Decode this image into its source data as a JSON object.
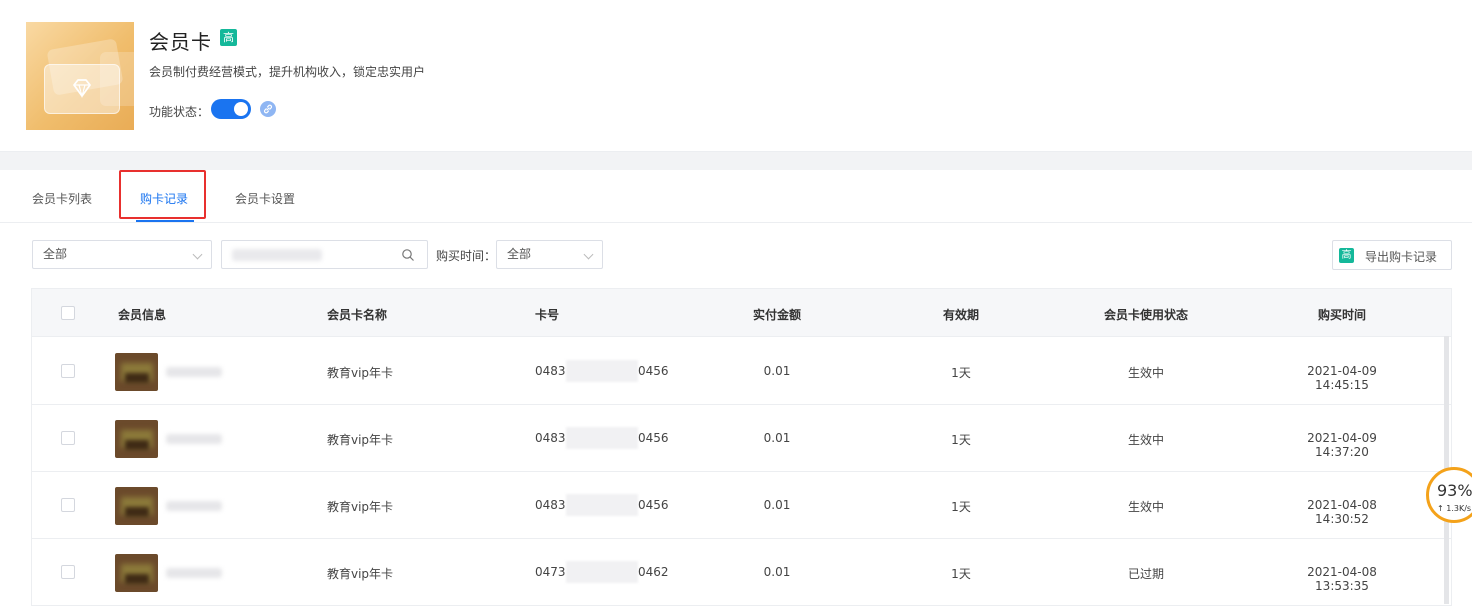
{
  "header": {
    "title": "会员卡",
    "badge": "高",
    "description": "会员制付费经营模式，提升机构收入，锁定忠实用户",
    "status_label": "功能状态："
  },
  "tabs": [
    {
      "label": "会员卡列表"
    },
    {
      "label": "购卡记录",
      "active": true
    },
    {
      "label": "会员卡设置"
    }
  ],
  "filters": {
    "member_select": "全部",
    "buy_time_label": "购买时间：",
    "buy_time_select": "全部",
    "export_badge": "高",
    "export_label": "导出购卡记录"
  },
  "table": {
    "headers": [
      "会员信息",
      "会员卡名称",
      "卡号",
      "实付金额",
      "有效期",
      "会员卡使用状态",
      "购买时间"
    ],
    "rows": [
      {
        "card_name": "教育vip年卡",
        "card_prefix": "0483",
        "card_suffix": "0456",
        "amount": "0.01",
        "validity": "1天",
        "status": "生效中",
        "time": "2021-04-09 14:45:15"
      },
      {
        "card_name": "教育vip年卡",
        "card_prefix": "0483",
        "card_suffix": "0456",
        "amount": "0.01",
        "validity": "1天",
        "status": "生效中",
        "time": "2021-04-09 14:37:20"
      },
      {
        "card_name": "教育vip年卡",
        "card_prefix": "0483",
        "card_suffix": "0456",
        "amount": "0.01",
        "validity": "1天",
        "status": "生效中",
        "time": "2021-04-08 14:30:52"
      },
      {
        "card_name": "教育vip年卡",
        "card_prefix": "0473",
        "card_suffix": "0462",
        "amount": "0.01",
        "validity": "1天",
        "status": "已过期",
        "time": "2021-04-08 13:53:35"
      }
    ]
  },
  "speed_widget": {
    "percent": "93%",
    "rate": "↑ 1.3K/s"
  },
  "colors": {
    "accent": "#1a74f0",
    "badge": "#14b89a",
    "highlight": "#e8302e",
    "card_gold": "#f0bd6c"
  }
}
